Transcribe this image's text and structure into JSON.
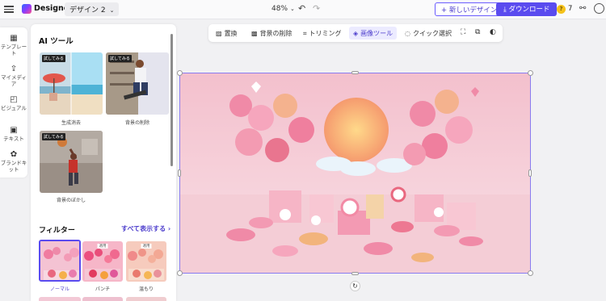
{
  "header": {
    "app_title": "Designer",
    "design_name": "デザイン 2",
    "zoom": "48%",
    "new_design_label": "+ 新しいデザイン",
    "download_label": "ダウンロード",
    "coin_count": "7"
  },
  "rail": {
    "items": [
      {
        "label": "テンプレート",
        "icon": "template-icon"
      },
      {
        "label": "マイメディア",
        "icon": "upload-icon"
      },
      {
        "label": "ビジュアル",
        "icon": "shapes-icon"
      },
      {
        "label": "テキスト",
        "icon": "text-icon"
      },
      {
        "label": "ブランドキット",
        "icon": "brand-kit-icon"
      }
    ]
  },
  "panel": {
    "title": "AI ツール",
    "tools": [
      {
        "label": "生成消去",
        "badge": "試してみる"
      },
      {
        "label": "背景の削除",
        "badge": "試してみる"
      },
      {
        "label": "背景のぼかし",
        "badge": "試してみる"
      }
    ],
    "filters_title": "フィルター",
    "show_all": "すべて表示する ›",
    "filters": [
      {
        "label": "ノーマル",
        "tag": ""
      },
      {
        "label": "パンチ",
        "tag": "適用"
      },
      {
        "label": "温もり",
        "tag": "適用"
      }
    ]
  },
  "toolbar": {
    "items": [
      {
        "label": "置換",
        "icon": "image-icon"
      },
      {
        "label": "背景の削除",
        "icon": "remove-bg-icon"
      },
      {
        "label": "トリミング",
        "icon": "crop-icon"
      },
      {
        "label": "画像ツール",
        "icon": "image-tools-icon"
      },
      {
        "label": "クイック選択",
        "icon": "lasso-icon"
      }
    ]
  },
  "colors": {
    "accent": "#5a4bef",
    "accent_text": "#4b3ccc",
    "selection_border": "#8a7cf0"
  }
}
